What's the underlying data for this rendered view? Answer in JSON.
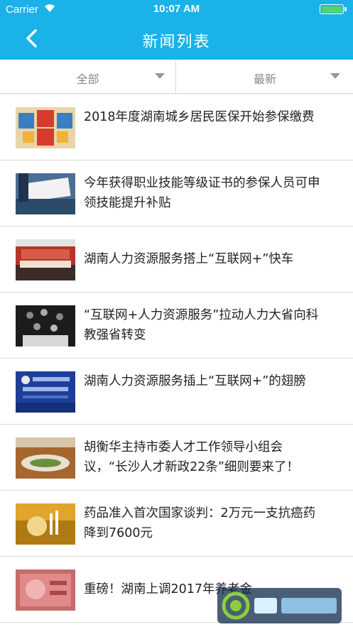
{
  "status": {
    "carrier": "Carrier",
    "time": "10:07 AM"
  },
  "nav": {
    "title": "新闻列表"
  },
  "filters": {
    "left": "全部",
    "right": "最新"
  },
  "news": [
    {
      "headline": "2018年度湖南城乡居民医保开始参保缴费"
    },
    {
      "headline": "今年获得职业技能等级证书的参保人员可申领技能提升补贴"
    },
    {
      "headline": "湖南人力资源服务搭上“互联网+”快车"
    },
    {
      "headline": "“互联网+人力资源服务”拉动人力大省向科教强省转变"
    },
    {
      "headline": "湖南人力资源服务插上“互联网+”的翅膀"
    },
    {
      "headline": "胡衡华主持市委人才工作领导小组会议，“长沙人才新政22条”细则要来了！"
    },
    {
      "headline": "药品准入首次国家谈判：2万元一支抗癌药降到7600元"
    },
    {
      "headline": "重磅！湖南上调2017年养老金"
    }
  ],
  "colors": {
    "nav_bg": "#1ab2e8",
    "battery_fill": "#57d36b"
  },
  "icons": {
    "back": "chevron-left-icon",
    "wifi": "wifi-icon",
    "dropdown": "triangle-down-icon"
  }
}
